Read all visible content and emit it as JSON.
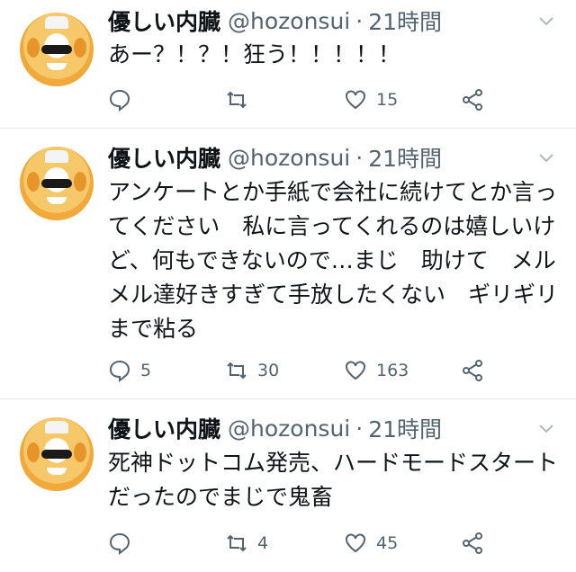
{
  "tweets": [
    {
      "author": "優しい内臓",
      "handle": "@hozonsui",
      "separator": "·",
      "time": "21時間",
      "text": "あー？！？！狂う！！！！！",
      "replies": "",
      "retweets": "",
      "likes": "15"
    },
    {
      "author": "優しい内臓",
      "handle": "@hozonsui",
      "separator": "·",
      "time": "21時間",
      "text": "アンケートとか手紙で会社に続けてとか言ってください　私に言ってくれるのは嬉しいけど、何もできないので…まじ　助けて　メルメル達好きすぎて手放したくない　ギリギリまで粘る",
      "replies": "5",
      "retweets": "30",
      "likes": "163"
    },
    {
      "author": "優しい内臓",
      "handle": "@hozonsui",
      "separator": "·",
      "time": "21時間",
      "text": "死神ドットコム発売、ハードモードスタートだったのでまじで鬼畜",
      "replies": "",
      "retweets": "4",
      "likes": "45"
    }
  ],
  "icons": {
    "reply": "reply-icon",
    "retweet": "retweet-icon",
    "like": "heart-icon",
    "share": "share-icon",
    "more": "chevron-down-icon"
  },
  "colors": {
    "text": "#0f1419",
    "secondary": "#536471",
    "divider": "#e6e9ec"
  }
}
